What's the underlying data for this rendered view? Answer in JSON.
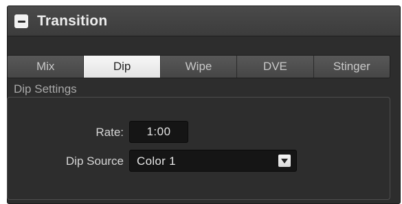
{
  "panel": {
    "title": "Transition",
    "collapse_icon": "minus-icon"
  },
  "tabs": [
    {
      "label": "Mix",
      "active": false
    },
    {
      "label": "Dip",
      "active": true
    },
    {
      "label": "Wipe",
      "active": false
    },
    {
      "label": "DVE",
      "active": false
    },
    {
      "label": "Stinger",
      "active": false
    }
  ],
  "dip_settings": {
    "legend": "Dip Settings",
    "rate_label": "Rate:",
    "rate_value": "1:00",
    "source_label": "Dip Source",
    "source_value": "Color 1",
    "dropdown_icon": "triangle-down-icon"
  },
  "colors": {
    "panel_bg": "#2d2d2d",
    "active_tab": "#efefef",
    "field_bg": "#151515"
  }
}
